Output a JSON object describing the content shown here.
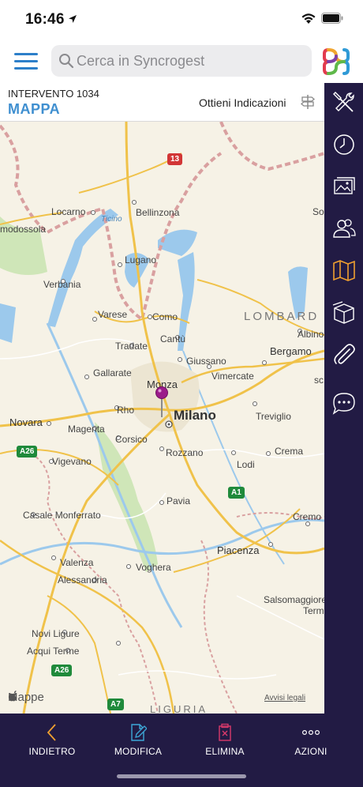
{
  "status": {
    "time": "16:46"
  },
  "search": {
    "placeholder": "Cerca in Syncrogest"
  },
  "intervention": {
    "code": "INTERVENTO 1034",
    "section": "MAPPA",
    "directions_label": "Ottieni Indicazioni"
  },
  "sidebar": {
    "items": [
      {
        "icon": "tools-icon"
      },
      {
        "icon": "clock-icon"
      },
      {
        "icon": "photos-icon"
      },
      {
        "icon": "users-icon"
      },
      {
        "icon": "map-icon",
        "active": true
      },
      {
        "icon": "box-icon"
      },
      {
        "icon": "paperclip-icon"
      },
      {
        "icon": "chat-icon"
      }
    ],
    "active_color": "#f0a030"
  },
  "map": {
    "labels": {
      "locarno": "Locarno",
      "ticino": "Ticino",
      "bellinzona": "Bellinzona",
      "domodossola": "modossola",
      "lugano": "Lugano",
      "verbania": "Verbania",
      "varese": "Varese",
      "como": "Como",
      "lombard": "LOMBARD",
      "tradate": "Tradate",
      "cantu": "Cantù",
      "albino": "Albino",
      "bergamo": "Bergamo",
      "giussano": "Giussano",
      "vimercate": "Vimercate",
      "gallarate": "Gallarate",
      "monza": "Monza",
      "rho": "Rho",
      "milano": "Milano",
      "treviglio": "Treviglio",
      "novara": "Novara",
      "magenta": "Magenta",
      "corsico": "Corsico",
      "rozzano": "Rozzano",
      "crema": "Crema",
      "vigevano": "Vigevano",
      "lodi": "Lodi",
      "pavia": "Pavia",
      "casale": "Casale Monferrato",
      "cremo": "Cremo",
      "valenza": "Valenza",
      "voghera": "Voghera",
      "piacenza": "Piacenza",
      "alessandria": "Alessandria",
      "salsomaggiore": "Salsomaggiore",
      "terme": "Terme",
      "novi": "Novi Ligure",
      "acqui": "Acqui Terme",
      "liguria": "LIGURIA",
      "so": "So",
      "sc": "sc"
    },
    "shields": {
      "r13": "13",
      "a26": "A26",
      "a1": "A1",
      "a26b": "A26",
      "a7": "A7"
    },
    "credit": "Mappe",
    "legal": "Avvisi legali"
  },
  "toolbar": {
    "back": "INDIETRO",
    "edit": "MODIFICA",
    "delete": "ELIMINA",
    "actions": "AZIONI"
  },
  "colors": {
    "brand_blue": "#3f8fd0",
    "bar_dark": "#221b44",
    "pin": "#9b1b8a"
  }
}
